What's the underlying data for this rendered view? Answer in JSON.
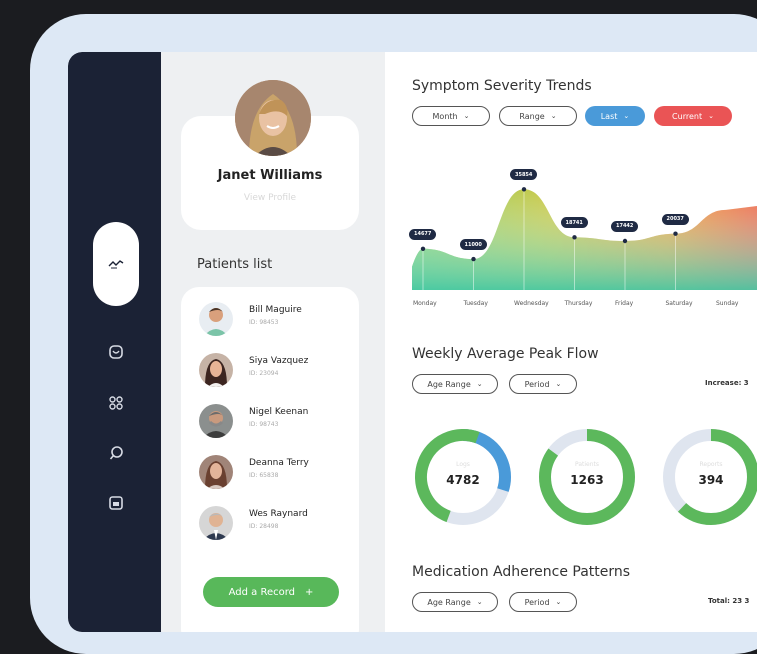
{
  "profile": {
    "name": "Janet Williams",
    "view_profile": "View Profile"
  },
  "patients": {
    "title": "Patients list",
    "items": [
      {
        "name": "Bill Maguire",
        "id": "ID: 98453"
      },
      {
        "name": "Siya Vazquez",
        "id": "ID: 23094"
      },
      {
        "name": "Nigel Keenan",
        "id": "ID: 98743"
      },
      {
        "name": "Deanna Terry",
        "id": "ID: 65838"
      },
      {
        "name": "Wes Raynard",
        "id": "ID: 28498"
      }
    ],
    "add_record": "Add a Record",
    "add_icon": "+"
  },
  "sidebar": {
    "active_icon": "activity-icon",
    "icons": [
      "heart-icon",
      "grid-icon",
      "chat-icon",
      "calendar-icon"
    ]
  },
  "symptom": {
    "title": "Symptom Severity Trends",
    "filters": {
      "month": "Month",
      "range": "Range",
      "last": "Last",
      "current": "Current"
    },
    "colors": {
      "last": "#4a9ad9",
      "current": "#ea5455"
    }
  },
  "chart_data": {
    "type": "area",
    "categories": [
      "Monday",
      "Tuesday",
      "Wednesday",
      "Thursday",
      "Friday",
      "Saturday",
      "Sunday"
    ],
    "series": [
      {
        "values": [
          14677,
          11000,
          35854,
          18741,
          17442,
          20037,
          28500
        ]
      }
    ],
    "labels": [
      "14677",
      "11000",
      "35854",
      "18741",
      "17442",
      "20037"
    ]
  },
  "peak_flow": {
    "title": "Weekly Average Peak Flow",
    "filters": {
      "age_range": "Age Range",
      "period": "Period"
    },
    "note": "Increase: 3",
    "donuts": [
      {
        "label": "Logs",
        "value": "4782",
        "fraction": 0.3,
        "color": "#4a9ad9"
      },
      {
        "label": "Patients",
        "value": "1263",
        "fraction": 0.85,
        "color": "#5cb85c"
      },
      {
        "label": "Reports",
        "value": "394",
        "fraction": 0.62,
        "color": "#5cb85c"
      }
    ]
  },
  "medication": {
    "title": "Medication Adherence Patterns",
    "filters": {
      "age_range": "Age Range",
      "period": "Period"
    },
    "note": "Total: 23 3"
  }
}
